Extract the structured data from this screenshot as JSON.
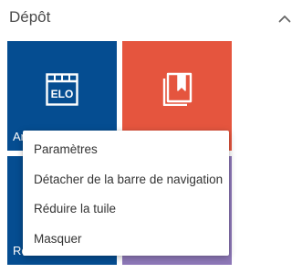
{
  "section": {
    "title": "Dépôt",
    "collapse_icon": "chevron-up-icon"
  },
  "tiles": [
    {
      "label": "Ar",
      "color": "#054d91",
      "icon": "elo-app-icon",
      "icon_text": "ELO"
    },
    {
      "label": "",
      "color": "#e5553e",
      "icon": "books-icon"
    },
    {
      "label": "Re",
      "color": "#054d91",
      "icon": ""
    },
    {
      "label": "",
      "color": "#8e78b8",
      "icon": ""
    }
  ],
  "context_menu": {
    "items": [
      {
        "label": "Paramètres"
      },
      {
        "label": "Détacher de la barre de navigation"
      },
      {
        "label": "Réduire la tuile"
      },
      {
        "label": "Masquer"
      }
    ]
  }
}
